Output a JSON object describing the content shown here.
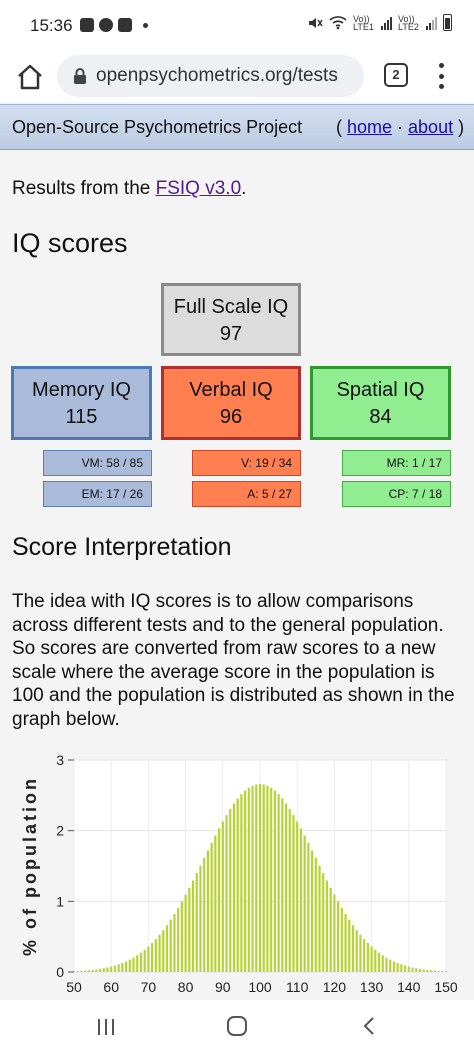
{
  "status_bar": {
    "time": "15:36",
    "lte1": "Vo)) LTE1",
    "lte2": "Vo)) LTE2"
  },
  "browser": {
    "url": "openpsychometrics.org/tests",
    "tab_count": "2"
  },
  "site": {
    "title": "Open-Source Psychometrics Project",
    "open_paren": "( ",
    "home": "home",
    "sep": " · ",
    "about": "about",
    "close_paren": " )"
  },
  "results": {
    "prefix": "Results from the ",
    "test_link": "FSIQ v3.0",
    "suffix": "."
  },
  "iq_heading": "IQ scores",
  "scores": {
    "full": {
      "label": "Full Scale IQ",
      "value": "97"
    },
    "memory": {
      "label": "Memory IQ",
      "value": "115"
    },
    "verbal": {
      "label": "Verbal IQ",
      "value": "96"
    },
    "spatial": {
      "label": "Spatial IQ",
      "value": "84"
    }
  },
  "subscores": {
    "vm": "VM: 58 / 85",
    "em": "EM: 17 / 26",
    "v": "V: 19 / 34",
    "a": "A: 5 / 27",
    "mr": "MR: 1 / 17",
    "cp": "CP: 7 / 18"
  },
  "interp_heading": "Score Interpretation",
  "interp_text": "The idea with IQ scores is to allow comparisons across different tests and to the general population. So scores are converted from raw scores to a new scale where the average score in the population is 100 and the population is distributed as shown in the graph below.",
  "chart_data": {
    "type": "bar",
    "ylabel": "% of population",
    "xlabel": "",
    "x_ticks": [
      "50",
      "60",
      "70",
      "80",
      "90",
      "100",
      "110",
      "120",
      "130",
      "140",
      "150"
    ],
    "y_ticks": [
      "0",
      "1",
      "2",
      "3"
    ],
    "xlim": [
      50,
      150
    ],
    "ylim": [
      0,
      3
    ],
    "distribution": {
      "mean": 100,
      "sd": 15,
      "step": 1
    },
    "color": "#b5d334",
    "grid": true
  }
}
